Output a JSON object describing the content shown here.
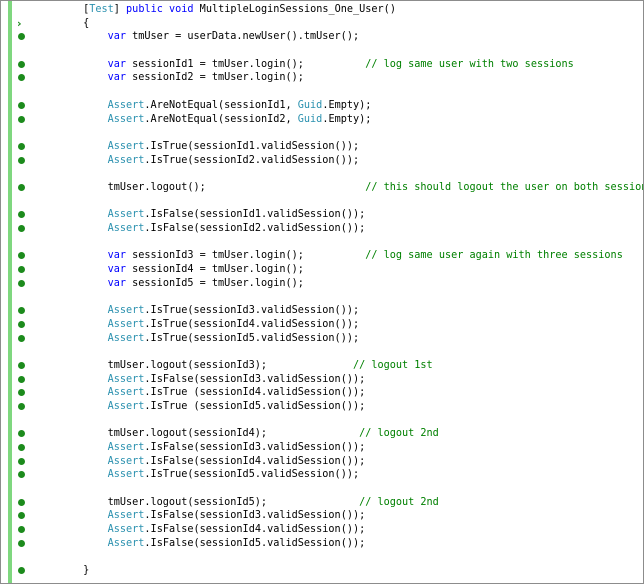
{
  "editor": {
    "colors": {
      "keyword": "#0000ff",
      "type": "#2b91af",
      "comment": "#008000",
      "plain": "#000000",
      "coverage_marker": "#1c8b1c",
      "change_bar": "#7fd77f"
    },
    "lines": [
      {
        "marker": "none",
        "tokens": [
          {
            "t": "        ",
            "k": "plain"
          },
          {
            "t": "[",
            "k": "plain"
          },
          {
            "t": "Test",
            "k": "type"
          },
          {
            "t": "] ",
            "k": "plain"
          },
          {
            "t": "public",
            "k": "keyword"
          },
          {
            "t": " ",
            "k": "plain"
          },
          {
            "t": "void",
            "k": "keyword"
          },
          {
            "t": " MultipleLoginSessions_One_User()",
            "k": "plain"
          }
        ]
      },
      {
        "marker": "arrow",
        "tokens": [
          {
            "t": "        {",
            "k": "plain"
          }
        ]
      },
      {
        "marker": "dot",
        "tokens": [
          {
            "t": "            ",
            "k": "plain"
          },
          {
            "t": "var",
            "k": "keyword"
          },
          {
            "t": " tmUser = userData.newUser().tmUser();",
            "k": "plain"
          }
        ]
      },
      {
        "marker": "none",
        "tokens": []
      },
      {
        "marker": "dot",
        "tokens": [
          {
            "t": "            ",
            "k": "plain"
          },
          {
            "t": "var",
            "k": "keyword"
          },
          {
            "t": " sessionId1 = tmUser.login();          ",
            "k": "plain"
          },
          {
            "t": "// log same user with two sessions",
            "k": "comment"
          }
        ]
      },
      {
        "marker": "dot",
        "tokens": [
          {
            "t": "            ",
            "k": "plain"
          },
          {
            "t": "var",
            "k": "keyword"
          },
          {
            "t": " sessionId2 = tmUser.login();",
            "k": "plain"
          }
        ]
      },
      {
        "marker": "none",
        "tokens": []
      },
      {
        "marker": "dot",
        "tokens": [
          {
            "t": "            ",
            "k": "plain"
          },
          {
            "t": "Assert",
            "k": "type"
          },
          {
            "t": ".AreNotEqual(sessionId1, ",
            "k": "plain"
          },
          {
            "t": "Guid",
            "k": "type"
          },
          {
            "t": ".Empty);",
            "k": "plain"
          }
        ]
      },
      {
        "marker": "dot",
        "tokens": [
          {
            "t": "            ",
            "k": "plain"
          },
          {
            "t": "Assert",
            "k": "type"
          },
          {
            "t": ".AreNotEqual(sessionId2, ",
            "k": "plain"
          },
          {
            "t": "Guid",
            "k": "type"
          },
          {
            "t": ".Empty);",
            "k": "plain"
          }
        ]
      },
      {
        "marker": "none",
        "tokens": []
      },
      {
        "marker": "dot",
        "tokens": [
          {
            "t": "            ",
            "k": "plain"
          },
          {
            "t": "Assert",
            "k": "type"
          },
          {
            "t": ".IsTrue(sessionId1.validSession());",
            "k": "plain"
          }
        ]
      },
      {
        "marker": "dot",
        "tokens": [
          {
            "t": "            ",
            "k": "plain"
          },
          {
            "t": "Assert",
            "k": "type"
          },
          {
            "t": ".IsTrue(sessionId2.validSession());",
            "k": "plain"
          }
        ]
      },
      {
        "marker": "none",
        "tokens": []
      },
      {
        "marker": "dot",
        "tokens": [
          {
            "t": "            tmUser.logout();                          ",
            "k": "plain"
          },
          {
            "t": "// this should logout the user on both sessions",
            "k": "comment"
          }
        ]
      },
      {
        "marker": "none",
        "tokens": []
      },
      {
        "marker": "dot",
        "tokens": [
          {
            "t": "            ",
            "k": "plain"
          },
          {
            "t": "Assert",
            "k": "type"
          },
          {
            "t": ".IsFalse(sessionId1.validSession());",
            "k": "plain"
          }
        ]
      },
      {
        "marker": "dot",
        "tokens": [
          {
            "t": "            ",
            "k": "plain"
          },
          {
            "t": "Assert",
            "k": "type"
          },
          {
            "t": ".IsFalse(sessionId2.validSession());",
            "k": "plain"
          }
        ]
      },
      {
        "marker": "none",
        "tokens": []
      },
      {
        "marker": "dot",
        "tokens": [
          {
            "t": "            ",
            "k": "plain"
          },
          {
            "t": "var",
            "k": "keyword"
          },
          {
            "t": " sessionId3 = tmUser.login();          ",
            "k": "plain"
          },
          {
            "t": "// log same user again with three sessions",
            "k": "comment"
          }
        ]
      },
      {
        "marker": "dot",
        "tokens": [
          {
            "t": "            ",
            "k": "plain"
          },
          {
            "t": "var",
            "k": "keyword"
          },
          {
            "t": " sessionId4 = tmUser.login();",
            "k": "plain"
          }
        ]
      },
      {
        "marker": "dot",
        "tokens": [
          {
            "t": "            ",
            "k": "plain"
          },
          {
            "t": "var",
            "k": "keyword"
          },
          {
            "t": " sessionId5 = tmUser.login();",
            "k": "plain"
          }
        ]
      },
      {
        "marker": "none",
        "tokens": []
      },
      {
        "marker": "dot",
        "tokens": [
          {
            "t": "            ",
            "k": "plain"
          },
          {
            "t": "Assert",
            "k": "type"
          },
          {
            "t": ".IsTrue(sessionId3.validSession());",
            "k": "plain"
          }
        ]
      },
      {
        "marker": "dot",
        "tokens": [
          {
            "t": "            ",
            "k": "plain"
          },
          {
            "t": "Assert",
            "k": "type"
          },
          {
            "t": ".IsTrue(sessionId4.validSession());",
            "k": "plain"
          }
        ]
      },
      {
        "marker": "dot",
        "tokens": [
          {
            "t": "            ",
            "k": "plain"
          },
          {
            "t": "Assert",
            "k": "type"
          },
          {
            "t": ".IsTrue(sessionId5.validSession());",
            "k": "plain"
          }
        ]
      },
      {
        "marker": "none",
        "tokens": []
      },
      {
        "marker": "dot",
        "tokens": [
          {
            "t": "            tmUser.logout(sessionId3);              ",
            "k": "plain"
          },
          {
            "t": "// logout 1st",
            "k": "comment"
          }
        ]
      },
      {
        "marker": "dot",
        "tokens": [
          {
            "t": "            ",
            "k": "plain"
          },
          {
            "t": "Assert",
            "k": "type"
          },
          {
            "t": ".IsFalse(sessionId3.validSession());",
            "k": "plain"
          }
        ]
      },
      {
        "marker": "dot",
        "tokens": [
          {
            "t": "            ",
            "k": "plain"
          },
          {
            "t": "Assert",
            "k": "type"
          },
          {
            "t": ".IsTrue (sessionId4.validSession());",
            "k": "plain"
          }
        ]
      },
      {
        "marker": "dot",
        "tokens": [
          {
            "t": "            ",
            "k": "plain"
          },
          {
            "t": "Assert",
            "k": "type"
          },
          {
            "t": ".IsTrue (sessionId5.validSession());",
            "k": "plain"
          }
        ]
      },
      {
        "marker": "none",
        "tokens": []
      },
      {
        "marker": "dot",
        "tokens": [
          {
            "t": "            tmUser.logout(sessionId4);               ",
            "k": "plain"
          },
          {
            "t": "// logout 2nd",
            "k": "comment"
          }
        ]
      },
      {
        "marker": "dot",
        "tokens": [
          {
            "t": "            ",
            "k": "plain"
          },
          {
            "t": "Assert",
            "k": "type"
          },
          {
            "t": ".IsFalse(sessionId3.validSession());",
            "k": "plain"
          }
        ]
      },
      {
        "marker": "dot",
        "tokens": [
          {
            "t": "            ",
            "k": "plain"
          },
          {
            "t": "Assert",
            "k": "type"
          },
          {
            "t": ".IsFalse(sessionId4.validSession());",
            "k": "plain"
          }
        ]
      },
      {
        "marker": "dot",
        "tokens": [
          {
            "t": "            ",
            "k": "plain"
          },
          {
            "t": "Assert",
            "k": "type"
          },
          {
            "t": ".IsTrue(sessionId5.validSession());",
            "k": "plain"
          }
        ]
      },
      {
        "marker": "none",
        "tokens": []
      },
      {
        "marker": "dot",
        "tokens": [
          {
            "t": "            tmUser.logout(sessionId5);               ",
            "k": "plain"
          },
          {
            "t": "// logout 2nd",
            "k": "comment"
          }
        ]
      },
      {
        "marker": "dot",
        "tokens": [
          {
            "t": "            ",
            "k": "plain"
          },
          {
            "t": "Assert",
            "k": "type"
          },
          {
            "t": ".IsFalse(sessionId3.validSession());",
            "k": "plain"
          }
        ]
      },
      {
        "marker": "dot",
        "tokens": [
          {
            "t": "            ",
            "k": "plain"
          },
          {
            "t": "Assert",
            "k": "type"
          },
          {
            "t": ".IsFalse(sessionId4.validSession());",
            "k": "plain"
          }
        ]
      },
      {
        "marker": "dot",
        "tokens": [
          {
            "t": "            ",
            "k": "plain"
          },
          {
            "t": "Assert",
            "k": "type"
          },
          {
            "t": ".IsFalse(sessionId5.validSession());",
            "k": "plain"
          }
        ]
      },
      {
        "marker": "none",
        "tokens": []
      },
      {
        "marker": "dot",
        "tokens": [
          {
            "t": "        }",
            "k": "plain"
          }
        ]
      }
    ]
  }
}
